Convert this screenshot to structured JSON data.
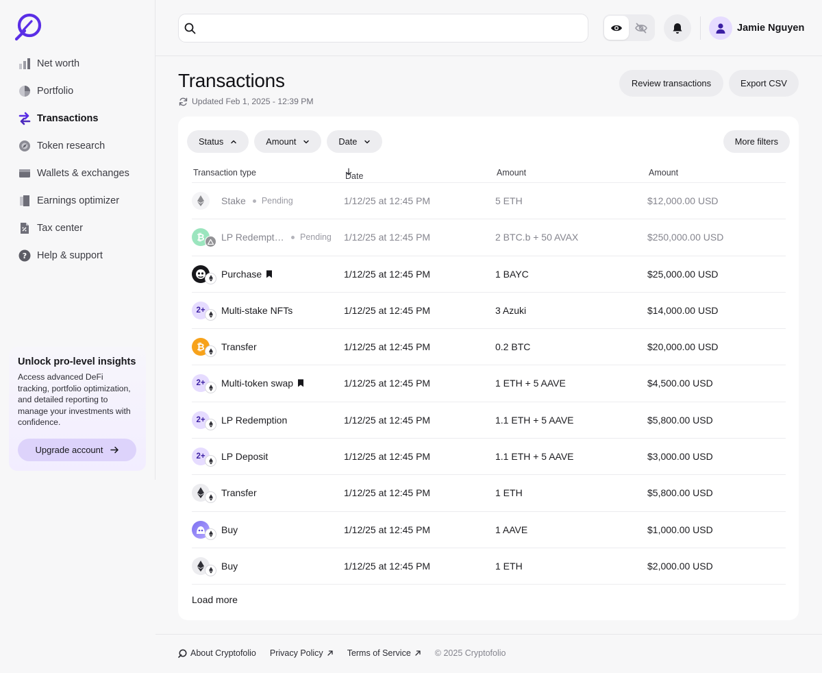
{
  "brand": {
    "accent": "#5a2ee6",
    "accent_light": "#e6dcff"
  },
  "sidebar": {
    "items": [
      {
        "label": "Net worth",
        "icon": "bar-chart-icon"
      },
      {
        "label": "Portfolio",
        "icon": "pie-chart-icon"
      },
      {
        "label": "Transactions",
        "icon": "swap-arrows-icon",
        "active": true
      },
      {
        "label": "Token research",
        "icon": "compass-icon"
      },
      {
        "label": "Wallets & exchanges",
        "icon": "wallet-icon"
      },
      {
        "label": "Earnings optimizer",
        "icon": "documents-icon"
      },
      {
        "label": "Tax center",
        "icon": "tax-document-icon"
      },
      {
        "label": "Help & support",
        "icon": "help-circle-icon"
      }
    ],
    "promo": {
      "title": "Unlock pro-level insights",
      "body": "Access advanced DeFi tracking, portfolio optimization, and detailed reporting to manage your investments with confidence.",
      "button": "Upgrade account"
    }
  },
  "header": {
    "search_placeholder": "",
    "user_name": "Jamie Nguyen"
  },
  "page": {
    "title": "Transactions",
    "updated": "Updated Feb 1, 2025 - 12:39 PM",
    "review_button": "Review transactions",
    "export_button": "Export CSV"
  },
  "filters": {
    "status": "Status",
    "amount": "Amount",
    "date": "Date",
    "more": "More filters"
  },
  "table": {
    "columns": [
      "Transaction type",
      "Date",
      "Amount",
      "Amount"
    ],
    "rows": [
      {
        "type": "Stake",
        "status": "Pending",
        "date": "1/12/25 at 12:45 PM",
        "amount": "5 ETH",
        "usd": "$12,000.00 USD",
        "icon": "eth",
        "bookmark": false
      },
      {
        "type": "LP Redemption",
        "status": "Pending",
        "date": "1/12/25 at 12:45 PM",
        "amount": "2 BTC.b + 50 AVAX",
        "usd": "$250,000.00 USD",
        "icon": "btcb",
        "bookmark": false
      },
      {
        "type": "Purchase",
        "status": "",
        "date": "1/12/25 at 12:45 PM",
        "amount": "1 BAYC",
        "usd": "$25,000.00 USD",
        "icon": "bayc",
        "bookmark": true
      },
      {
        "type": "Multi-stake NFTs",
        "status": "",
        "date": "1/12/25 at 12:45 PM",
        "amount": "3 Azuki",
        "usd": "$14,000.00 USD",
        "icon": "multi",
        "bookmark": false
      },
      {
        "type": "Transfer",
        "status": "",
        "date": "1/12/25 at 12:45 PM",
        "amount": "0.2 BTC",
        "usd": "$20,000.00 USD",
        "icon": "btc",
        "bookmark": false
      },
      {
        "type": "Multi-token swap",
        "status": "",
        "date": "1/12/25 at 12:45 PM",
        "amount": "1 ETH + 5 AAVE",
        "usd": "$4,500.00 USD",
        "icon": "multi",
        "bookmark": true
      },
      {
        "type": "LP Redemption",
        "status": "",
        "date": "1/12/25 at 12:45 PM",
        "amount": "1.1 ETH + 5 AAVE",
        "usd": "$5,800.00 USD",
        "icon": "multi",
        "bookmark": false
      },
      {
        "type": "LP Deposit",
        "status": "",
        "date": "1/12/25 at 12:45 PM",
        "amount": "1.1 ETH + 5 AAVE",
        "usd": "$3,000.00 USD",
        "icon": "multi",
        "bookmark": false
      },
      {
        "type": "Transfer",
        "status": "",
        "date": "1/12/25 at 12:45 PM",
        "amount": "1 ETH",
        "usd": "$5,800.00 USD",
        "icon": "eth",
        "bookmark": false
      },
      {
        "type": "Buy",
        "status": "",
        "date": "1/12/25 at 12:45 PM",
        "amount": "1 AAVE",
        "usd": "$1,000.00 USD",
        "icon": "aave",
        "bookmark": false
      },
      {
        "type": "Buy",
        "status": "",
        "date": "1/12/25 at 12:45 PM",
        "amount": "1 ETH",
        "usd": "$2,000.00 USD",
        "icon": "eth",
        "bookmark": false
      }
    ],
    "multi_label": "2+",
    "load_more": "Load more"
  },
  "footer": {
    "about": "About Cryptofolio",
    "privacy": "Privacy Policy",
    "terms": "Terms of Service",
    "copyright": "© 2025 Cryptofolio"
  }
}
